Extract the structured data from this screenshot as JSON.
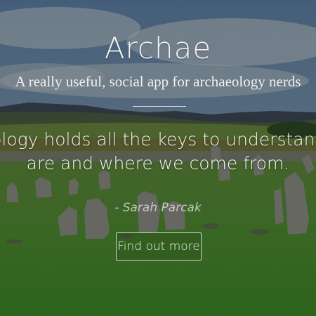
{
  "hero": {
    "title": "Archae",
    "subtitle": "A really useful, social app for archaeology nerds",
    "quote_line_1": "Archaeology holds all the keys to understanding who we",
    "quote_line_2": "are and where we come from.",
    "attribution": "- Sarah Parcak",
    "cta_label": "Find out more"
  }
}
